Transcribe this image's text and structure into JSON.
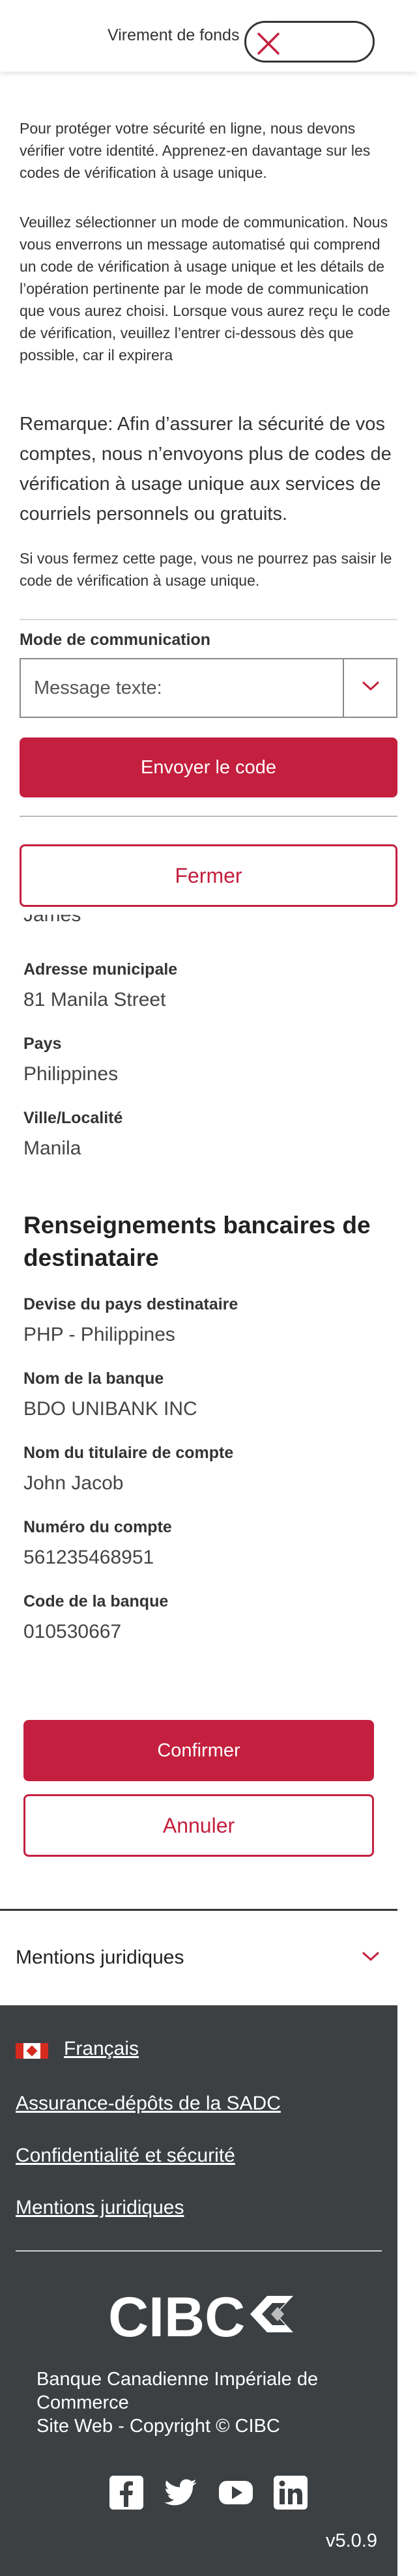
{
  "header": {
    "title": "Virement de fonds"
  },
  "modal": {
    "intro": "Pour protéger votre sécurité en ligne, nous devons vérifier votre identité. Apprenez-en davantage sur les codes de vérification à usage unique.",
    "instructions": "Veuillez sélectionner un mode de communication. Nous vous enverrons un message automatisé qui comprend un code de vérification à usage unique et les détails de l’opération pertinente par le mode de communication que vous aurez choisi. Lorsque vous aurez reçu le code de vérification, veuillez l’entrer ci-dessous dès que possible, car il expirera",
    "note": "Remarque: Afin d’assurer la sécurité de vos comptes, nous n’envoyons plus de codes de vérification à usage unique aux services de courriels personnels ou gratuits.",
    "warning": "Si vous fermez cette page, vous ne pourrez pas saisir le code de vérification à usage unique.",
    "comm_label": "Mode de communication",
    "comm_value": "Message texte:",
    "send_button": "Envoyer le code",
    "close_button": "Fermer"
  },
  "recipient": {
    "partial_name": "James",
    "address_label": "Adresse municipale",
    "address_value": "81 Manila Street",
    "country_label": "Pays",
    "country_value": "Philippines",
    "city_label": "Ville/Localité",
    "city_value": "Manila"
  },
  "bank": {
    "section_title": "Renseignements bancaires de destinataire",
    "currency_label": "Devise du pays destinataire",
    "currency_value": "PHP - Philippines",
    "bank_name_label": "Nom de la banque",
    "bank_name_value": "BDO UNIBANK INC",
    "holder_label": "Nom du titulaire de compte",
    "holder_value": "John Jacob",
    "account_label": "Numéro du compte",
    "account_value": "561235468951",
    "bank_code_label": "Code de la banque",
    "bank_code_value": "010530667"
  },
  "actions": {
    "confirm": "Confirmer",
    "cancel": "Annuler"
  },
  "legal": {
    "label": "Mentions juridiques"
  },
  "footer": {
    "language": "Français",
    "link_cdic": "Assurance-dépôts de la SADC",
    "link_privacy": "Confidentialité et sécurité",
    "link_legal": "Mentions juridiques",
    "logo_text": "CIBC",
    "bank_name": "Banque Canadienne Impériale de Commerce",
    "copyright": "Site Web - Copyright © CIBC",
    "version": "v5.0.9",
    "social": [
      "facebook-icon",
      "twitter-icon",
      "youtube-icon",
      "linkedin-icon"
    ]
  },
  "colors": {
    "brand_red": "#c41f3e",
    "footer_bg": "#3d4043"
  }
}
